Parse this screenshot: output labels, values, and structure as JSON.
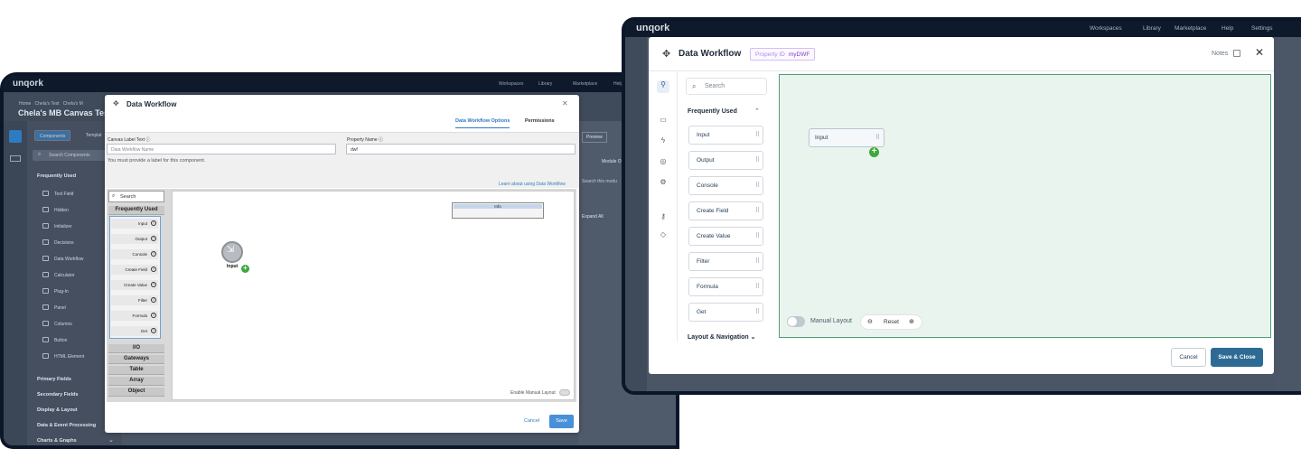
{
  "left": {
    "logo": "unqork",
    "nav": [
      "Workspaces",
      "Library",
      "Marketplace",
      "Help"
    ],
    "breadcrumbs": [
      "Home",
      "Chela's Test",
      "Chela's M"
    ],
    "page_title": "Chela's MB Canvas Test",
    "sidebar": {
      "tabs": [
        "Components",
        "Templat"
      ],
      "search_placeholder": "Search Components",
      "section_frequent": "Frequently Used",
      "items": [
        "Text Field",
        "Hidden",
        "Initializer",
        "Decisions",
        "Data Workflow",
        "Calculator",
        "Plug-In",
        "Panel",
        "Columns",
        "Button",
        "HTML Element"
      ],
      "sections": [
        "Primary Fields",
        "Secondary Fields",
        "Display & Layout",
        "Data & Event Processing",
        "Charts & Graphs"
      ]
    },
    "right_panel": {
      "preview": "Preview",
      "module": "Module O",
      "search": "Search this modu",
      "expand": "Expand All"
    },
    "modal": {
      "title": "Data Workflow",
      "tabs": [
        "Data Workflow Options",
        "Permissions"
      ],
      "canvas_label": "Canvas Label Text",
      "canvas_placeholder": "Data Workflow Name",
      "error": "You must provide a label for this component.",
      "property_label": "Property Name",
      "property_value": "dwf",
      "learn_link": "Learn about using Data Workflow",
      "search": "Search",
      "group_frequent": "Frequently Used",
      "blocks": [
        "Input",
        "Output",
        "Console",
        "Create Field",
        "Create Value",
        "Filter",
        "Formula",
        "Get"
      ],
      "groups": [
        "I/O",
        "Gateways",
        "Table",
        "Array",
        "Object"
      ],
      "info": "Info",
      "node_label": "Input",
      "manual_layout": "Enable Manual Layout",
      "cancel": "Cancel",
      "save": "Save"
    }
  },
  "right": {
    "logo": "unqork",
    "nav": [
      "Workspaces",
      "Library",
      "Marketplace",
      "Help",
      "Settings"
    ],
    "modal": {
      "title": "Data Workflow",
      "property_id_label": "Property ID",
      "property_id_value": "myDWF",
      "notes": "Notes",
      "search": "Search",
      "frequently_used": "Frequently Used",
      "blocks": [
        "Input",
        "Output",
        "Console",
        "Create Field",
        "Create Value",
        "Filter",
        "Formula",
        "Get"
      ],
      "layout_nav": "Layout & Navigation",
      "node_label": "Input",
      "manual_layout": "Manual Layout",
      "reset": "Reset",
      "cancel": "Cancel",
      "save_close": "Save & Close"
    }
  }
}
